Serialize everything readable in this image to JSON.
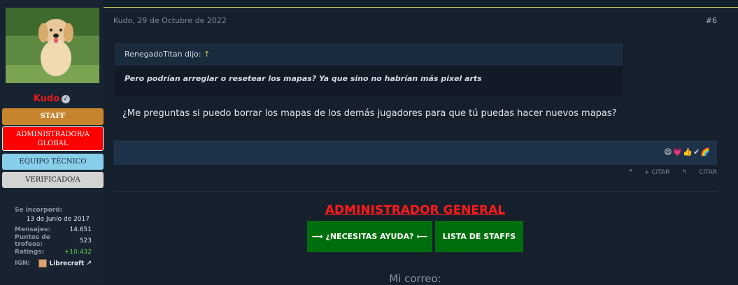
{
  "user": {
    "name": "Kudo",
    "badges": {
      "staff": "STAFF",
      "admin_line1": "ADMINISTRADOR/A",
      "admin_line2": "GLOBAL",
      "tech": "EQUIPO TÉCNICO",
      "verified": "VERIFICADO/A"
    },
    "stats": {
      "joined_label": "Se incorporó:",
      "joined_value": "13 de Junio de 2017",
      "messages_label": "Mensajes:",
      "messages_value": "14.651",
      "trophies_label": "Puntos de trofeos:",
      "trophies_value": "523",
      "ratings_label": "Ratings:",
      "ratings_value": "+10.432",
      "ign_label": "IGN:",
      "ign_value": "Librecraft"
    }
  },
  "post": {
    "date": "Kudo, 29 de Octubre de 2022",
    "number": "#6",
    "quote_author": "RenegadoTitan dijo:",
    "quote_arrow": "↑",
    "quote_text": "Pero podrían arreglar o resetear los mapas? Ya que sino no habrían más pixel arts",
    "message": "¿Me preguntas si puedo borrar los mapas de los demás jugadores para que tú puedas hacer nuevos mapas?",
    "reactions": "😄💗👍✔🌈",
    "actions": {
      "multi_quote": "+ CITAR",
      "quote": "CITAR"
    }
  },
  "signature": {
    "title": "ADMINISTRADOR GENERAL",
    "help_button": "⟶ ¿NECESITAS AYUDA? ⟵",
    "staff_button": "LISTA DE STAFFS",
    "mail_label": "Mi correo:"
  },
  "colors": {
    "accent_red": "#ff1a1a",
    "button_green": "#006e0c",
    "staff_orange": "#c8842d",
    "tech_blue": "#87ceeb"
  }
}
